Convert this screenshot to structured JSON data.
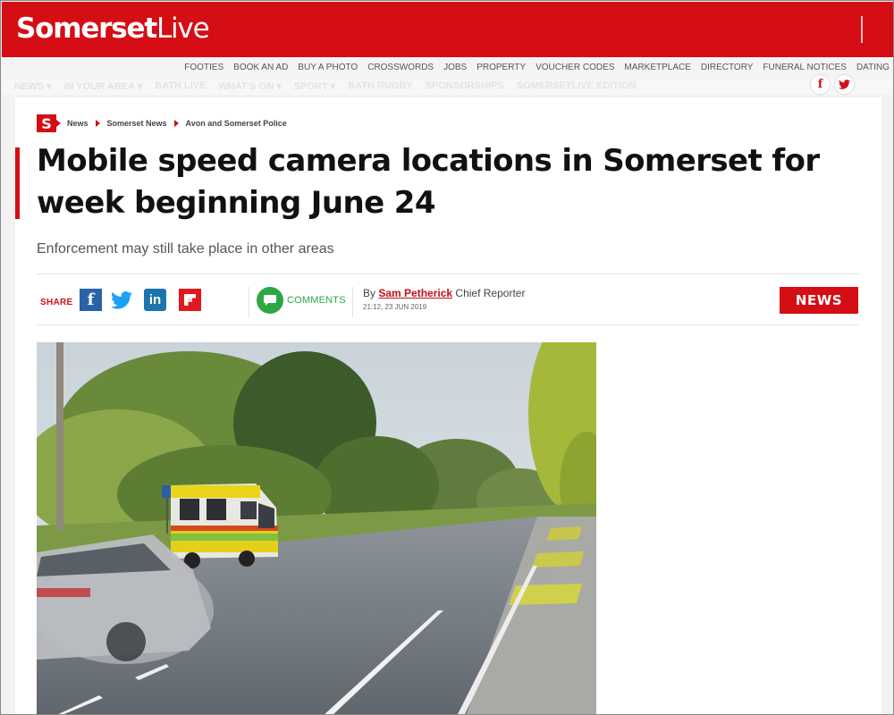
{
  "site": {
    "name_bold": "Somerset",
    "name_light": "Live"
  },
  "secondary_nav": [
    "FOOTIES",
    "BOOK AN AD",
    "BUY A PHOTO",
    "CROSSWORDS",
    "JOBS",
    "PROPERTY",
    "VOUCHER CODES",
    "MARKETPLACE",
    "DIRECTORY",
    "FUNERAL NOTICES",
    "DATING"
  ],
  "main_nav": [
    "NEWS ▾",
    "IN YOUR AREA ▾",
    "BATH LIVE",
    "WHAT'S ON ▾",
    "SPORT ▾",
    "BATH RUGBY",
    "SPONSORSHIPS",
    "SOMERSETLIVE EDITION"
  ],
  "social_top": {
    "facebook": "f",
    "twitter": "twitter-icon"
  },
  "breadcrumb": {
    "logo": "S",
    "items": [
      "News",
      "Somerset News",
      "Avon and Somerset Police"
    ]
  },
  "article": {
    "headline": "Mobile speed camera locations in Somerset for week beginning June 24",
    "standfirst": "Enforcement may still take place in other areas",
    "share_label": "SHARE",
    "comments_label": "COMMENTS",
    "by": "By",
    "author": "Sam Petherick",
    "author_role": "Chief Reporter",
    "timestamp": "21:12, 23 JUN 2019",
    "section_badge": "NEWS"
  },
  "share_buttons": {
    "facebook": "f",
    "linkedin": "in"
  },
  "colors": {
    "brand_red": "#d40e14",
    "comments_green": "#2fa644",
    "facebook_blue": "#2b62a7",
    "twitter_blue": "#1da1f2",
    "linkedin_blue": "#1c74ac"
  }
}
